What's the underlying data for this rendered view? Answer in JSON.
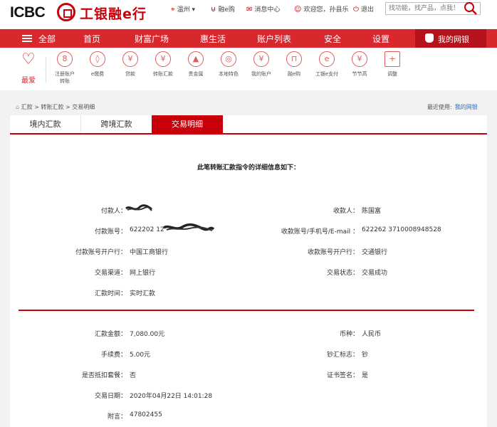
{
  "brand": {
    "name_en": "ICBC",
    "name_cn": "工银融e行"
  },
  "toplinks": {
    "city": "温州",
    "rong_e_gou": "融e购",
    "messages": "消息中心",
    "welcome": "欢迎您，孙县乐",
    "logout": "退出"
  },
  "search": {
    "placeholder": "找功能，找产品，点我！"
  },
  "nav": {
    "all": "全部",
    "items": [
      "首页",
      "财富广场",
      "惠生活",
      "账户列表",
      "安全",
      "设置"
    ],
    "my_bank": "我的网银"
  },
  "quick": {
    "favorite": "最爱",
    "items": [
      {
        "label": "注册账户\n转账",
        "icon": "account-transfer-icon",
        "glyph": "8"
      },
      {
        "label": "e缴费",
        "icon": "droplet-icon",
        "glyph": "◊"
      },
      {
        "label": "贷款",
        "icon": "money-bag-icon",
        "glyph": "¥"
      },
      {
        "label": "转账汇款",
        "icon": "transfer-icon",
        "glyph": "¥"
      },
      {
        "label": "贵金属",
        "icon": "gold-bars-icon",
        "glyph": "▲"
      },
      {
        "label": "本地特色",
        "icon": "local-feature-icon",
        "glyph": "◎"
      },
      {
        "label": "我的账户",
        "icon": "my-account-icon",
        "glyph": "¥"
      },
      {
        "label": "融e购",
        "icon": "shopping-icon",
        "glyph": "⊓"
      },
      {
        "label": "工银e支付",
        "icon": "e-pay-icon",
        "glyph": "e"
      },
      {
        "label": "节节高",
        "icon": "piggy-bank-icon",
        "glyph": "¥"
      },
      {
        "label": "调整",
        "icon": "adjust-plus-icon",
        "glyph": "+"
      }
    ]
  },
  "breadcrumb": {
    "text": "汇款 > 转账汇款 > 交易明细"
  },
  "recent": {
    "label": "最近使用:",
    "link": "我的网银"
  },
  "tabs": [
    "境内汇款",
    "跨境汇款",
    "交易明细"
  ],
  "detail": {
    "heading": "此笔转账汇款指令的详细信息如下：",
    "payer_label": "付款人：",
    "payer_value": "",
    "payee_label": "收款人：",
    "payee_value": "陈国富",
    "payer_account_label": "付款账号：",
    "payer_account_value": "622202 12",
    "payee_account_label": "收款账号/手机号/E-mail ：",
    "payee_account_value": "622262 3710008948528",
    "payer_bank_label": "付款账号开户行：",
    "payer_bank_value": "中国工商银行",
    "payee_bank_label": "收款账号开户行：",
    "payee_bank_value": "交通银行",
    "channel_label": "交易渠道：",
    "channel_value": "网上银行",
    "status_label": "交易状态：",
    "status_value": "交易成功",
    "time_label": "汇款时间：",
    "time_value": "实时汇款",
    "amount_label": "汇款金额：",
    "amount_value": "7,080.00元",
    "currency_label": "币种：",
    "currency_value": "人民币",
    "fee_label": "手续费：",
    "fee_value": "5.00元",
    "cash_flag_label": "钞汇标志：",
    "cash_flag_value": "钞",
    "package_label": "是否抵扣套餐：",
    "package_value": "否",
    "cert_label": "证书签名：",
    "cert_value": "是",
    "date_label": "交易日期：",
    "date_value": "2020年04月22日 14:01:28",
    "memo_label": "附言：",
    "memo_value": "47802455"
  },
  "colors": {
    "brand_red": "#c7000b",
    "nav_red": "#d9272e",
    "link_blue": "#2b6cc4"
  }
}
